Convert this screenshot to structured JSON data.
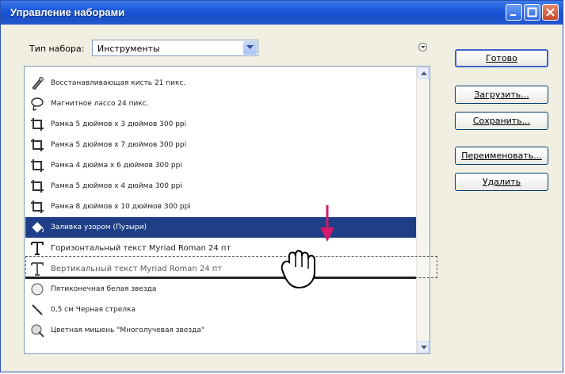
{
  "window": {
    "title": "Управление наборами"
  },
  "preset_type": {
    "label": "Тип набора:",
    "value": "Инструменты"
  },
  "buttons": {
    "done": "Готово",
    "load": "Загрузить...",
    "save": "Сохранить...",
    "rename": "Переименовать...",
    "delete": "Удалить"
  },
  "presets": [
    {
      "label": "Восстанавливающая кисть 21 пикс.",
      "icon": "healing-brush-icon"
    },
    {
      "label": "Магнитное лассо 24 пикс.",
      "icon": "magnetic-lasso-icon"
    },
    {
      "label": "Рамка 5 дюймов x 3 дюймов 300 ppi",
      "icon": "crop-icon"
    },
    {
      "label": "Рамка 5 дюймов x 7 дюймов 300 ppi",
      "icon": "crop-icon"
    },
    {
      "label": "Рамка 4 дюйма x 6 дюймов 300 ppi",
      "icon": "crop-icon"
    },
    {
      "label": "Рамка 5 дюймов x 4 дюйма 300 ppi",
      "icon": "crop-icon"
    },
    {
      "label": "Рамка 8 дюймов x 10 дюймов 300 ppi",
      "icon": "crop-icon"
    },
    {
      "label": "Заливка узором (Пузыри)",
      "icon": "paint-bucket-icon",
      "selected": true
    },
    {
      "label": "Горизонтальный текст Myriad Roman 24 пт",
      "icon": "text-tool-icon"
    },
    {
      "label": "Вертикальный текст Myriad Roman 24 пт",
      "icon": "text-tool-icon"
    },
    {
      "label": "Пятиконечная белая звезда",
      "icon": "star-shape-icon"
    },
    {
      "label": "0,5 см Черная стрелка",
      "icon": "arrow-line-icon"
    },
    {
      "label": "Цветная мишень \"Многолучевая звезда\"",
      "icon": "target-icon"
    }
  ],
  "colors": {
    "selection": "#1e3f86",
    "title_bar": "#1d58d8",
    "drag_arrow": "#d6186c"
  }
}
